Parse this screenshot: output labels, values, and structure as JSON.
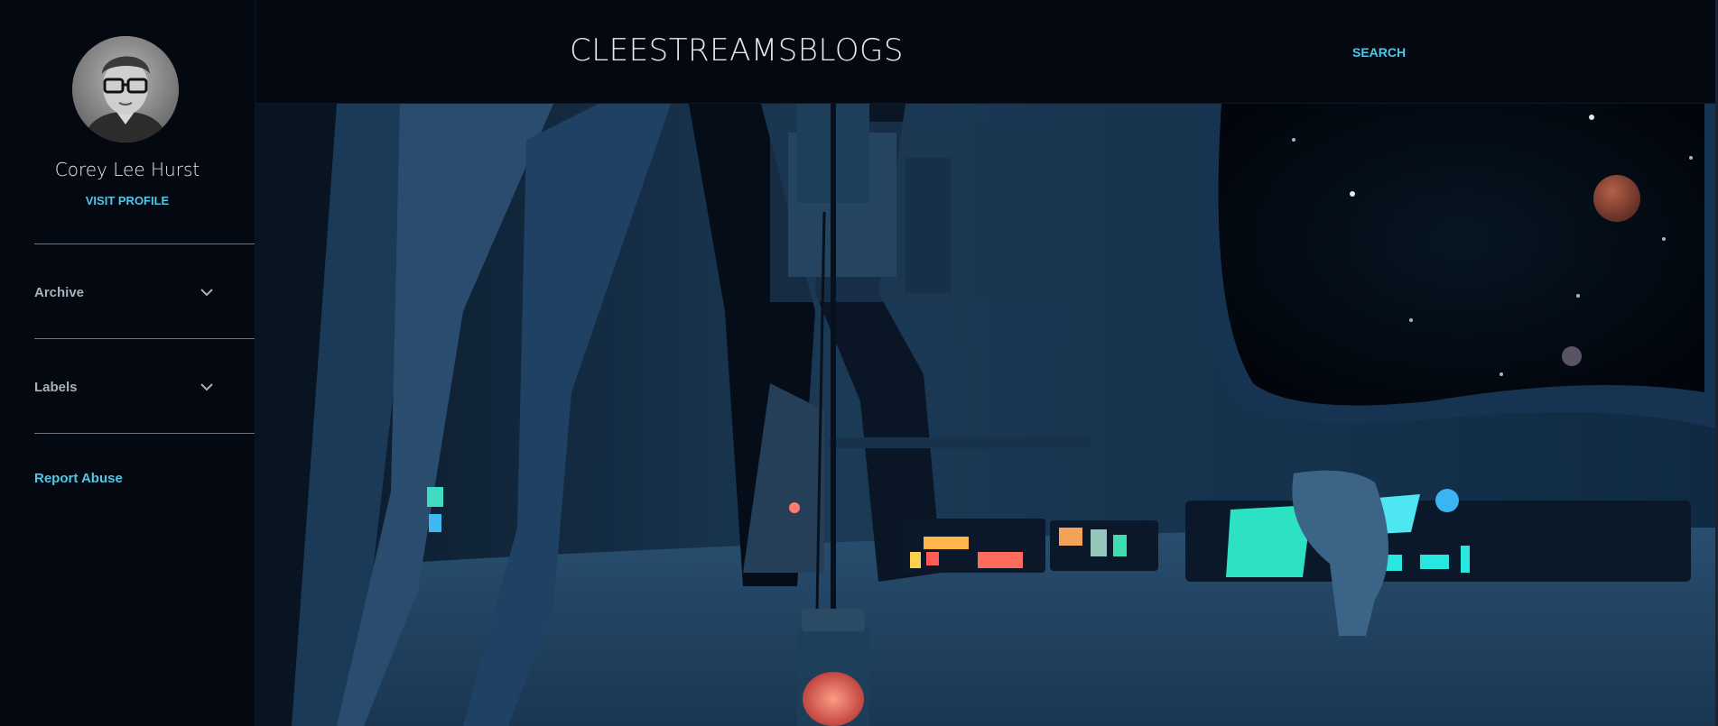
{
  "sidebar": {
    "profile_name": "Corey Lee Hurst",
    "visit_profile_label": "VISIT PROFILE",
    "widgets": [
      {
        "label": "Archive",
        "icon": "chevron-down-icon"
      },
      {
        "label": "Labels",
        "icon": "chevron-down-icon"
      }
    ],
    "report_abuse_label": "Report Abuse"
  },
  "header": {
    "site_title": "CLEESTREAMSBLOGS",
    "search_label": "SEARCH"
  },
  "colors": {
    "background": "#030811",
    "accent": "#52c7e6",
    "text_primary": "#e4e9ef",
    "text_muted": "#aab1bb"
  }
}
